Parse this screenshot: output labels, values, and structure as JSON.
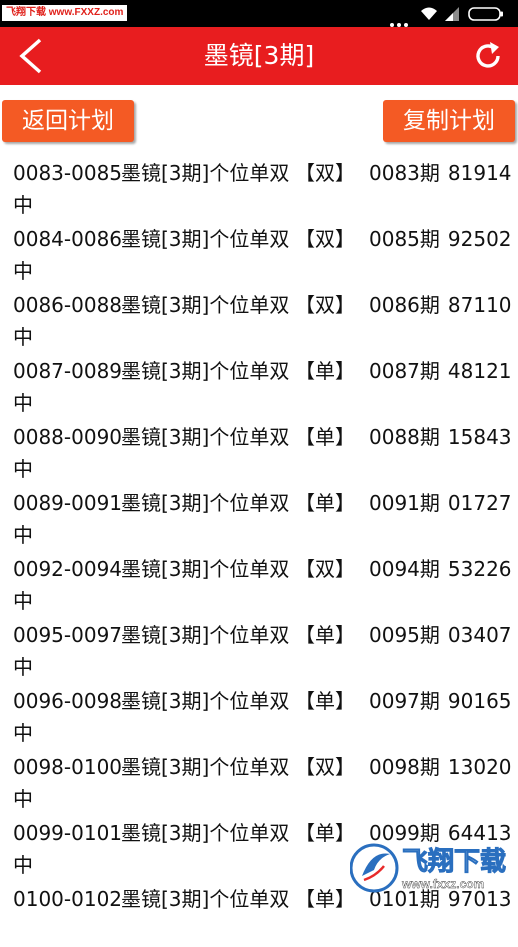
{
  "status_bar": {
    "source_badge": "飞翔下载 www.FXXZ.com",
    "icons": [
      "more-dots-icon",
      "wifi-icon",
      "signal-icon",
      "battery-icon"
    ]
  },
  "header": {
    "title": "墨镜[3期]",
    "back_icon": "back-arrow-icon",
    "refresh_icon": "refresh-icon"
  },
  "actions": {
    "back_plan": "返回计划",
    "copy_plan": "复制计划"
  },
  "records": [
    {
      "range": "0083-0085",
      "plan": "墨镜[3期]个位单双",
      "tag": "【双】",
      "issue": "0083期",
      "number": "81914",
      "result": "中"
    },
    {
      "range": "0084-0086",
      "plan": "墨镜[3期]个位单双",
      "tag": "【双】",
      "issue": "0085期",
      "number": "92502",
      "result": "中"
    },
    {
      "range": "0086-0088",
      "plan": "墨镜[3期]个位单双",
      "tag": "【双】",
      "issue": "0086期",
      "number": "87110",
      "result": "中"
    },
    {
      "range": "0087-0089",
      "plan": "墨镜[3期]个位单双",
      "tag": "【单】",
      "issue": "0087期",
      "number": "48121",
      "result": "中"
    },
    {
      "range": "0088-0090",
      "plan": "墨镜[3期]个位单双",
      "tag": "【单】",
      "issue": "0088期",
      "number": "15843",
      "result": "中"
    },
    {
      "range": "0089-0091",
      "plan": "墨镜[3期]个位单双",
      "tag": "【单】",
      "issue": "0091期",
      "number": "01727",
      "result": "中"
    },
    {
      "range": "0092-0094",
      "plan": "墨镜[3期]个位单双",
      "tag": "【双】",
      "issue": "0094期",
      "number": "53226",
      "result": "中"
    },
    {
      "range": "0095-0097",
      "plan": "墨镜[3期]个位单双",
      "tag": "【单】",
      "issue": "0095期",
      "number": "03407",
      "result": "中"
    },
    {
      "range": "0096-0098",
      "plan": "墨镜[3期]个位单双",
      "tag": "【单】",
      "issue": "0097期",
      "number": "90165",
      "result": "中"
    },
    {
      "range": "0098-0100",
      "plan": "墨镜[3期]个位单双",
      "tag": "【双】",
      "issue": "0098期",
      "number": "13020",
      "result": "中"
    },
    {
      "range": "0099-0101",
      "plan": "墨镜[3期]个位单双",
      "tag": "【单】",
      "issue": "0099期",
      "number": "64413",
      "result": "中"
    },
    {
      "range": "0100-0102",
      "plan": "墨镜[3期]个位单双",
      "tag": "【单】",
      "issue": "0101期",
      "number": "97013",
      "result": ""
    }
  ],
  "watermark": {
    "brand": "飞翔下载",
    "url": "www.fxxz.com"
  },
  "colors": {
    "header_red": "#e81d1f",
    "button_orange": "#f45a24",
    "status_black": "#000000"
  }
}
